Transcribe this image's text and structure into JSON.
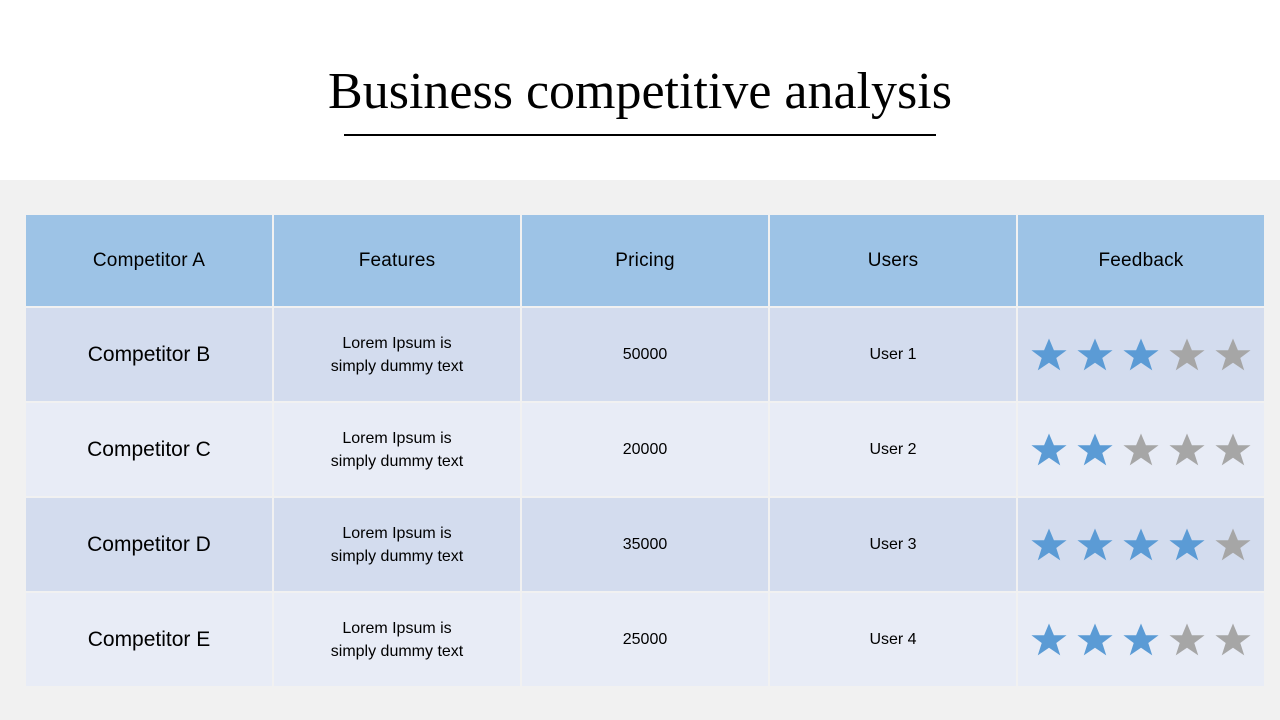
{
  "title": {
    "text": "Business competitive analysis"
  },
  "table": {
    "headers": [
      "Competitor A",
      "Features",
      "Pricing",
      "Users",
      "Feedback"
    ],
    "rows": [
      {
        "name": "Competitor B",
        "feature_line1": "Lorem Ipsum is",
        "feature_line2": "simply dummy text",
        "pricing": "50000",
        "users": "User 1",
        "rating": 3,
        "rating_max": 5
      },
      {
        "name": "Competitor C",
        "feature_line1": "Lorem Ipsum is",
        "feature_line2": "simply dummy text",
        "pricing": "20000",
        "users": "User 2",
        "rating": 2,
        "rating_max": 5
      },
      {
        "name": "Competitor D",
        "feature_line1": "Lorem Ipsum is",
        "feature_line2": "simply dummy text",
        "pricing": "35000",
        "users": "User 3",
        "rating": 4,
        "rating_max": 5
      },
      {
        "name": "Competitor E",
        "feature_line1": "Lorem Ipsum is",
        "feature_line2": "simply dummy text",
        "pricing": "25000",
        "users": "User 4",
        "rating": 3,
        "rating_max": 5
      }
    ]
  },
  "colors": {
    "header_bg": "#9dc3e6",
    "row_dark_bg": "#d3dcee",
    "row_light_bg": "#e8ecf6",
    "canvas_bg": "#f1f1f1",
    "star_filled": "#5b9bd5",
    "star_empty": "#a6a6a6",
    "text": "#000000"
  },
  "icons": {
    "star_filled": "star-filled-icon",
    "star_empty": "star-empty-icon"
  }
}
